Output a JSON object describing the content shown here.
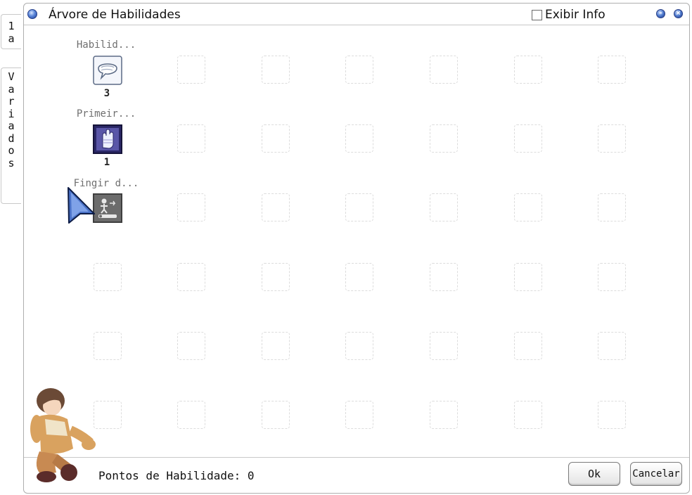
{
  "window": {
    "title": "Árvore de Habilidades",
    "info_toggle_label": "Exibir Info",
    "info_checked": false
  },
  "tabs": [
    {
      "label": "1a",
      "letters": [
        "1",
        "a"
      ]
    },
    {
      "label": "Variados",
      "letters": [
        "V",
        "a",
        "r",
        "i",
        "a",
        "d",
        "o",
        "s"
      ]
    }
  ],
  "skills": [
    {
      "name": "Habilid...",
      "level": "3",
      "icon": "speech-bubble-icon"
    },
    {
      "name": "Primeir...",
      "level": "1",
      "icon": "bandaged-hand-icon"
    },
    {
      "name": "Fingir d...",
      "level": "",
      "icon": "play-dead-icon"
    }
  ],
  "footer": {
    "points_label": "Pontos de Habilidade: 0",
    "ok_label": "Ok",
    "cancel_label": "Cancelar"
  },
  "colors": {
    "accent": "#3a5fbf",
    "border": "#aeaeae",
    "slot_border": "#dcdcdc",
    "skill_name": "#6f6f6f"
  }
}
